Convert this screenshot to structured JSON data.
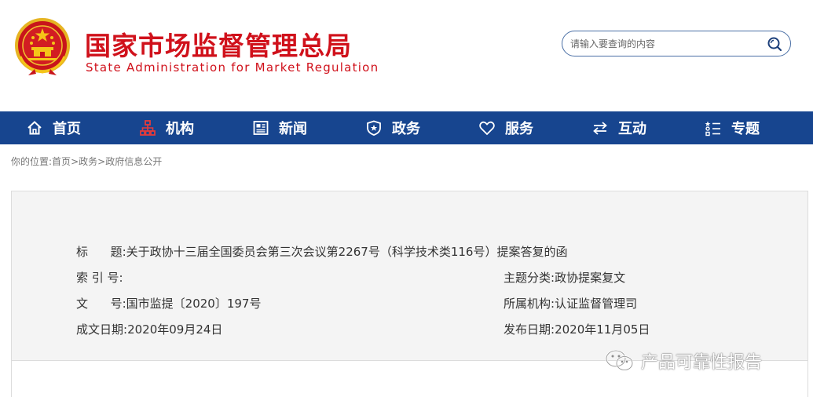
{
  "header": {
    "title_cn": "国家市场监督管理总局",
    "title_en": "State Administration for Market Regulation",
    "search_placeholder": "请输入要查询的内容"
  },
  "nav": [
    {
      "label": "首页",
      "icon": "home-icon"
    },
    {
      "label": "机构",
      "icon": "org-chart-icon"
    },
    {
      "label": "新闻",
      "icon": "newspaper-icon"
    },
    {
      "label": "政务",
      "icon": "shield-icon"
    },
    {
      "label": "服务",
      "icon": "heart-icon"
    },
    {
      "label": "互动",
      "icon": "swap-arrows-icon"
    },
    {
      "label": "专题",
      "icon": "topic-list-icon"
    }
  ],
  "breadcrumb": {
    "prefix": "你的位置:",
    "items": [
      "首页",
      "政务",
      "政府信息公开"
    ],
    "sep": ">"
  },
  "info": {
    "title_label": "标      题:",
    "title_value": "关于政协十三届全国委员会第三次会议第2267号（科学技术类116号）提案答复的函",
    "index_label": "索 引 号:",
    "index_value": "",
    "category_label": "主题分类:",
    "category_value": "政协提案复文",
    "docno_label": "文      号:",
    "docno_value": "国市监提〔2020〕197号",
    "org_label": "所属机构:",
    "org_value": "认证监督管理司",
    "date_label": "成文日期:",
    "date_value": "2020年09月24日",
    "pubdate_label": "发布日期:",
    "pubdate_value": "2020年11月05日"
  },
  "watermark": {
    "text": "产品可靠性报告",
    "icon": "wechat-icon"
  },
  "colors": {
    "brand_red": "#d0111b",
    "nav_blue": "#17458f",
    "panel_bg": "#f4f4f4"
  }
}
